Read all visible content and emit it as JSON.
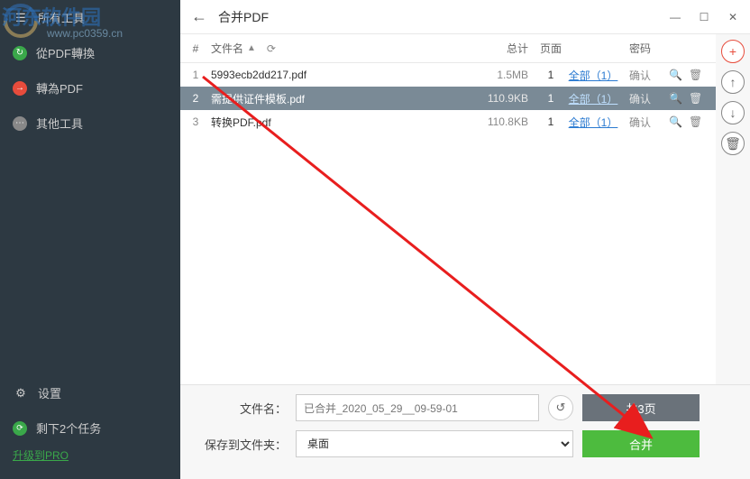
{
  "sidebar": {
    "items": [
      {
        "label": "所有工具"
      },
      {
        "label": "從PDF轉換"
      },
      {
        "label": "轉為PDF"
      },
      {
        "label": "其他工具"
      }
    ],
    "settings": "设置",
    "tasks": "剩下2个任务",
    "upgrade": "升级到PRO"
  },
  "title": "合并PDF",
  "table": {
    "head": {
      "num": "#",
      "name": "文件名",
      "size": "总计",
      "count": "页面",
      "page": "",
      "pwd": "密码"
    },
    "rows": [
      {
        "num": "1",
        "name": "5993ecb2dd217.pdf",
        "size": "1.5MB",
        "count": "1",
        "page": "全部（1）",
        "pwd": "确认",
        "sel": false
      },
      {
        "num": "2",
        "name": "需提供证件模板.pdf",
        "size": "110.9KB",
        "count": "1",
        "page": "全部（1）",
        "pwd": "确认",
        "sel": true
      },
      {
        "num": "3",
        "name": "转换PDF.pdf",
        "size": "110.8KB",
        "count": "1",
        "page": "全部（1）",
        "pwd": "确认",
        "sel": false
      }
    ]
  },
  "form": {
    "filename_label": "文件名：",
    "filename_value": "已合并_2020_05_29__09-59-01",
    "saveto_label": "保存到文件夹：",
    "saveto_value": "桌面",
    "pages_btn": "共3页",
    "merge_btn": "合并"
  },
  "watermark": {
    "brand": "河东软件园",
    "url": "www.pc0359.cn"
  }
}
